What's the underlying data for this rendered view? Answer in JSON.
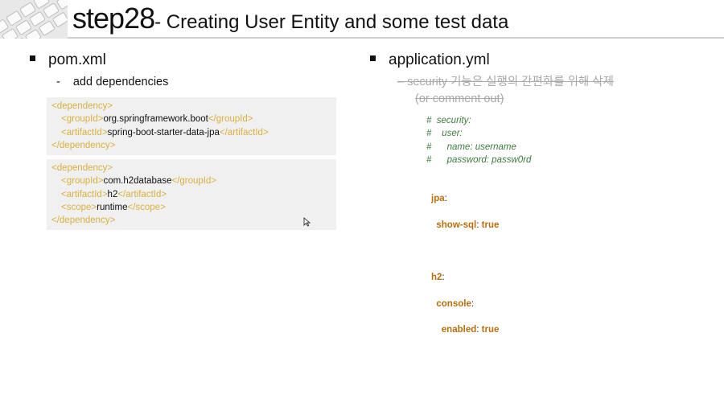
{
  "header": {
    "step": "step28",
    "dash": "- ",
    "title": "Creating User Entity and some test data"
  },
  "left": {
    "bullet": "pom.xml",
    "sub_dash": "-",
    "sub": "add dependencies",
    "box1": [
      {
        "open": "<dependency>",
        "indent": 0
      },
      {
        "open": "<groupId>",
        "text": "org.springframework.boot",
        "close": "</groupId>",
        "indent": 1
      },
      {
        "open": "<artifactId>",
        "text": "spring-boot-starter-data-jpa",
        "close": "</artifactId>",
        "indent": 1
      },
      {
        "open": "</dependency>",
        "indent": 0
      }
    ],
    "box2": [
      {
        "open": "<dependency>",
        "indent": 0
      },
      {
        "open": "<groupId>",
        "text": "com.h2database",
        "close": "</groupId>",
        "indent": 1
      },
      {
        "open": "<artifactId>",
        "text": "h2",
        "close": "</artifactId>",
        "indent": 1
      },
      {
        "open": "<scope>",
        "text": "runtime",
        "close": "</scope>",
        "indent": 1
      },
      {
        "open": "</dependency>",
        "indent": 0
      }
    ]
  },
  "right": {
    "bullet": "application.yml",
    "strike_line1": "–  security 기능은 실행의 간편화를 위해 삭제",
    "strike_line2": "(or comment out)",
    "comments": [
      "#  security:",
      "#    user:",
      "#      name: username",
      "#      password: passw0rd"
    ],
    "yaml": {
      "jpa_key": "jpa",
      "show_sql_key": "show-sql",
      "show_sql_val": "true",
      "h2_key": "h2",
      "console_key": "console",
      "enabled_key": "enabled",
      "enabled_val": "true",
      "colon": ":"
    }
  },
  "colors": {
    "tag": "#d9b040",
    "comment": "#3c7a3c",
    "yaml_key": "#b86e0c",
    "code_bg": "#f0f0f0"
  }
}
